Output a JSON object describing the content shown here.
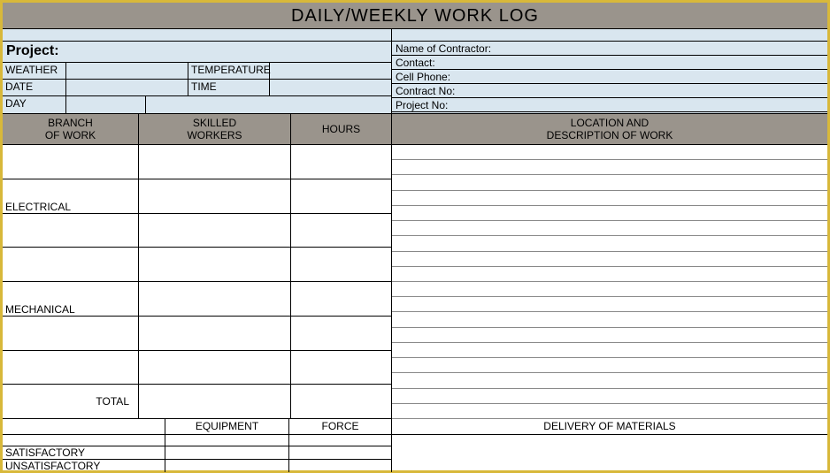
{
  "title": "DAILY/WEEKLY WORK LOG",
  "left": {
    "project_label": "Project:",
    "weather_label": "WEATHER",
    "weather_value": "",
    "temperature_label": "TEMPERATURE",
    "temperature_value": "",
    "date_label": "DATE",
    "date_value": "",
    "time_label": "TIME",
    "time_value": "",
    "day_label": "DAY",
    "day_value": ""
  },
  "right": {
    "name_label": "Name of Contractor:",
    "name_value": "",
    "contact_label": "Contact:",
    "contact_value": "",
    "cell_label": "Cell Phone:",
    "cell_value": "",
    "contract_label": "Contract No:",
    "contract_value": "",
    "projectno_label": "Project No:",
    "projectno_value": ""
  },
  "headers": {
    "branch1": "BRANCH",
    "branch2": "OF WORK",
    "skilled1": "SKILLED",
    "skilled2": "WORKERS",
    "hours": "HOURS",
    "loc1": "LOCATION AND",
    "loc2": "DESCRIPTION OF WORK"
  },
  "rows": {
    "r0": "",
    "r1": "ELECTRICAL",
    "r2": "",
    "r3": "",
    "r4": "MECHANICAL",
    "r5": "",
    "r6": "",
    "total": "TOTAL"
  },
  "lower": {
    "equipment": "EQUIPMENT",
    "force": "FORCE",
    "satisfactory": "SATISFACTORY",
    "unsatisfactory": "UNSATISFACTORY",
    "delivery": "DELIVERY OF MATERIALS"
  }
}
